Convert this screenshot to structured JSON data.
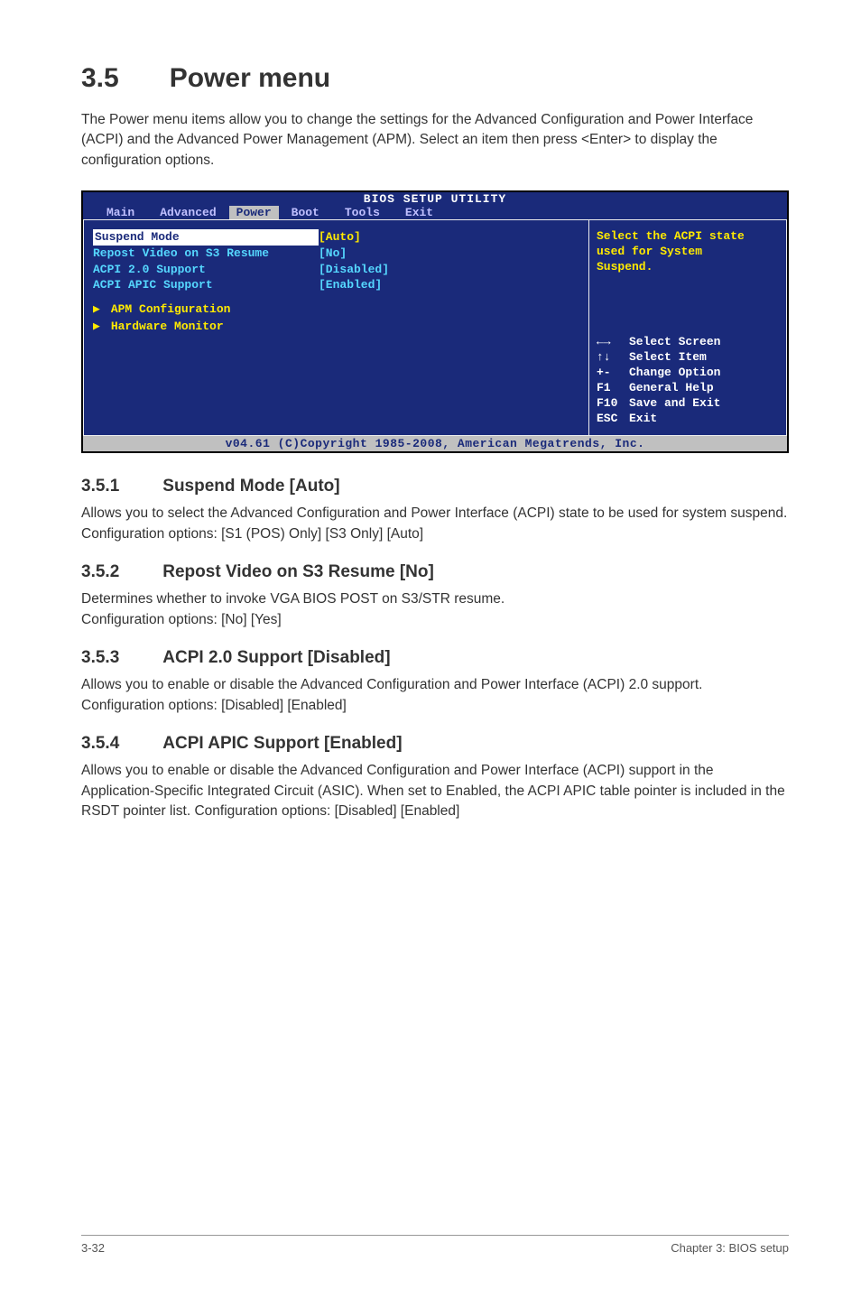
{
  "header": {
    "section_number": "3.5",
    "section_title": "Power menu",
    "intro": "The Power menu items allow you to change the settings for the Advanced Configuration and Power Interface (ACPI) and the Advanced Power Management (APM). Select an item then press <Enter> to display the configuration options."
  },
  "bios": {
    "title": "BIOS SETUP UTILITY",
    "menu": [
      "Main",
      "Advanced",
      "Power",
      "Boot",
      "Tools",
      "Exit"
    ],
    "rows": [
      {
        "label": "Suspend Mode",
        "value": "[Auto]",
        "selected": true
      },
      {
        "label": "Repost Video on S3 Resume",
        "value": "[No]"
      },
      {
        "label": "ACPI 2.0 Support",
        "value": "[Disabled]"
      },
      {
        "label": "ACPI APIC Support",
        "value": "[Enabled]"
      }
    ],
    "submenus": [
      "APM Configuration",
      "Hardware Monitor"
    ],
    "help_top_l1": "Select the ACPI state",
    "help_top_l2": "used for System",
    "help_top_l3": "Suspend.",
    "keys": [
      {
        "k": "←→",
        "d": "Select Screen"
      },
      {
        "k": "↑↓",
        "d": "Select Item"
      },
      {
        "k": "+-",
        "d": "Change Option"
      },
      {
        "k": "F1",
        "d": "General Help"
      },
      {
        "k": "F10",
        "d": "Save and Exit"
      },
      {
        "k": "ESC",
        "d": "Exit"
      }
    ],
    "footer": "v04.61 (C)Copyright 1985-2008, American Megatrends, Inc."
  },
  "subsections": {
    "s1": {
      "num": "3.5.1",
      "title": "Suspend Mode [Auto]",
      "p1": "Allows you to select the Advanced Configuration and Power Interface (ACPI) state to be used for system suspend.",
      "p2": "Configuration options: [S1 (POS) Only] [S3 Only] [Auto]"
    },
    "s2": {
      "num": "3.5.2",
      "title": "Repost Video on S3 Resume [No]",
      "p1": "Determines whether to invoke VGA BIOS POST on S3/STR resume.",
      "p2": "Configuration options: [No] [Yes]"
    },
    "s3": {
      "num": "3.5.3",
      "title": "ACPI 2.0 Support [Disabled]",
      "p1": "Allows you to enable or disable the Advanced Configuration and Power Interface (ACPI) 2.0 support.",
      "p2": "Configuration options: [Disabled] [Enabled]"
    },
    "s4": {
      "num": "3.5.4",
      "title": "ACPI APIC Support [Enabled]",
      "p1": "Allows you to enable or disable the Advanced Configuration and Power Interface (ACPI) support in the Application-Specific Integrated Circuit (ASIC). When set to Enabled, the ACPI APIC table pointer is included in the RSDT pointer list. Configuration options: [Disabled] [Enabled]"
    }
  },
  "page_footer": {
    "left": "3-32",
    "right": "Chapter 3: BIOS setup"
  }
}
